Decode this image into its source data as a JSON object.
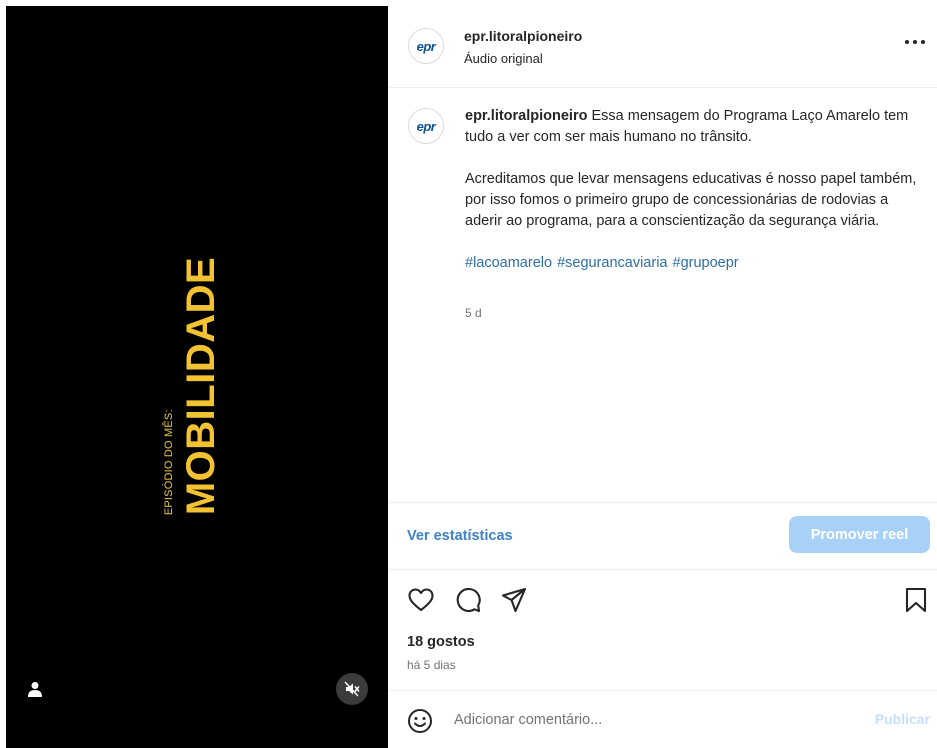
{
  "video": {
    "episode_label": "EPISÓDIO DO MÊS:",
    "title": "MOBILIDADE",
    "icons": {
      "user": "user-icon",
      "mute": "speaker-muted-icon"
    }
  },
  "post": {
    "username": "epr.litoralpioneiro",
    "audio": "Áudio original",
    "avatar_logo": "epr",
    "caption": {
      "username": "epr.litoralpioneiro",
      "paragraph1": "Essa mensagem do Programa Laço Amarelo tem tudo a ver com ser mais humano no trânsito.",
      "paragraph2": "Acreditamos que levar mensagens educativas é nosso papel também, por isso fomos o primeiro grupo de concessionárias de rodovias a aderir ao programa, para a conscientização da segurança viária.",
      "hashtags": [
        "#lacoamarelo",
        "#segurancaviaria",
        "#grupoepr"
      ],
      "time": "5 d"
    },
    "stats_link": "Ver estatísticas",
    "promote_label": "Promover reel",
    "likes": "18 gostos",
    "posted_ago": "há 5 dias",
    "comment_placeholder": "Adicionar comentário...",
    "publish_label": "Publicar"
  },
  "colors": {
    "accent_blue": "#3e82c7",
    "promote_bg": "#a8d1f7",
    "title_yellow": "#f2c230",
    "hashtag_blue": "#2d6fa5"
  }
}
